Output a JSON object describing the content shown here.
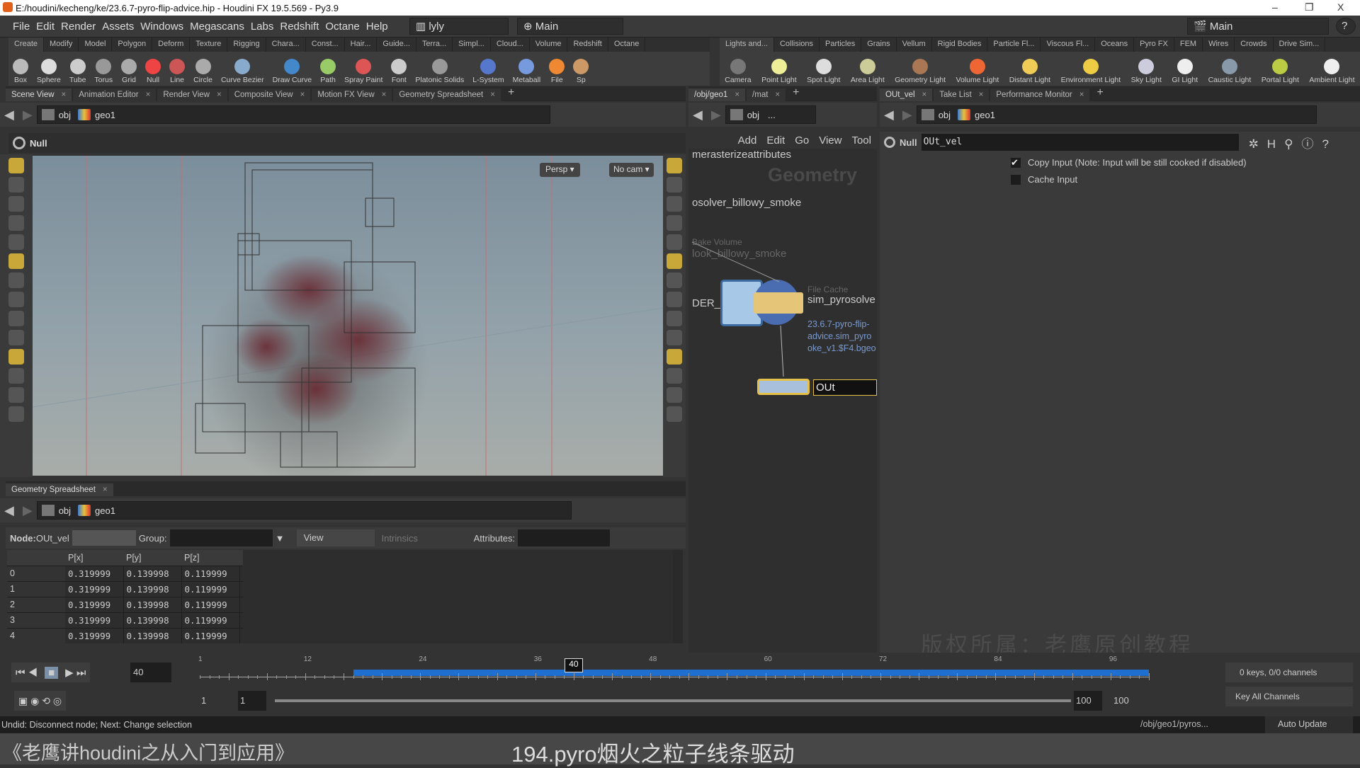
{
  "window": {
    "title": "E:/houdini/kecheng/ke/23.6.7-pyro-flip-advice.hip - Houdini FX 19.5.569 - Py3.9",
    "minimize": "–",
    "maximize": "❐",
    "close": "X"
  },
  "menu": [
    "File",
    "Edit",
    "Render",
    "Assets",
    "Windows",
    "Megascans",
    "Labs",
    "Redshift",
    "Octane",
    "Help"
  ],
  "desktop": "lyly",
  "main_sel": "Main",
  "main_right": "Main",
  "help": "?",
  "shelf_left_tabs": [
    "Create",
    "Modify",
    "Model",
    "Polygon",
    "Deform",
    "Texture",
    "Rigging",
    "Chara...",
    "Const...",
    "Hair...",
    "Guide...",
    "Terra...",
    "Simpl...",
    "Cloud...",
    "Volume",
    "Redshift",
    "Octane"
  ],
  "shelf_left_tools": [
    "Box",
    "Sphere",
    "Tube",
    "Torus",
    "Grid",
    "Null",
    "Line",
    "Circle",
    "Curve Bezier",
    "Draw Curve",
    "Path",
    "Spray Paint",
    "Font",
    "Platonic Solids",
    "L-System",
    "Metaball",
    "File",
    "Sp"
  ],
  "shelf_right_tabs": [
    "Lights and...",
    "Collisions",
    "Particles",
    "Grains",
    "Vellum",
    "Rigid Bodies",
    "Particle Fl...",
    "Viscous Fl...",
    "Oceans",
    "Pyro FX",
    "FEM",
    "Wires",
    "Crowds",
    "Drive Sim..."
  ],
  "shelf_right_tools": [
    "Camera",
    "Point Light",
    "Spot Light",
    "Area Light",
    "Geometry Light",
    "Volume Light",
    "Distant Light",
    "Environment Light",
    "Sky Light",
    "GI Light",
    "Caustic Light",
    "Portal Light",
    "Ambient Light"
  ],
  "left_tabs": [
    "Scene View",
    "Animation Editor",
    "Render View",
    "Composite View",
    "Motion FX View",
    "Geometry Spreadsheet"
  ],
  "path": {
    "obj": "obj",
    "geo": "geo1"
  },
  "viewport": {
    "node_type": "Null",
    "persp": "Persp ▾",
    "cam": "No cam ▾"
  },
  "net": {
    "tabs": [
      "/obj/geo1",
      "/mat"
    ],
    "path_obj": "obj",
    "path_more": "...",
    "menu": [
      "Add",
      "Edit",
      "Go",
      "View",
      "Tool"
    ],
    "label_top": "merasterizeattributes",
    "watermark": "Geometry",
    "node1": "osolver_billowy_smoke",
    "bake_type": "Bake Volume",
    "bake_name": "look_billowy_smoke",
    "left_cut": "DER_B",
    "cache_type": "File Cache",
    "cache_name": "sim_pyrosolve",
    "cache_file": [
      "23.6.7-pyro-flip-",
      "advice.sim_pyro",
      "oke_v1.$F4.bgeo"
    ],
    "null_type": "Null",
    "null_name": "OUt"
  },
  "params": {
    "tabs": [
      "OUt_vel",
      "Take List",
      "Performance Monitor"
    ],
    "node_type": "Null",
    "node_name": "OUt_vel",
    "copy_input": "Copy Input (Note: Input will be still cooked if disabled)",
    "copy_checked": true,
    "cache_input": "Cache Input",
    "cache_checked": false
  },
  "spreadsheet": {
    "tab": "Geometry Spreadsheet",
    "node_label": "Node:",
    "node": "OUt_vel",
    "group_label": "Group:",
    "view": "View",
    "intrinsics": "Intrinsics",
    "attributes_label": "Attributes:",
    "columns": [
      "",
      "P[x]",
      "P[y]",
      "P[z]"
    ],
    "rows": [
      [
        "0",
        "0.319999",
        "0.139998",
        "0.119999"
      ],
      [
        "1",
        "0.319999",
        "0.139998",
        "0.119999"
      ],
      [
        "2",
        "0.319999",
        "0.139998",
        "0.119999"
      ],
      [
        "3",
        "0.319999",
        "0.139998",
        "0.119999"
      ],
      [
        "4",
        "0.319999",
        "0.139998",
        "0.119999"
      ]
    ]
  },
  "timeline": {
    "frame": "40",
    "ticks": [
      "1",
      "12",
      "24",
      "36",
      "48",
      "60",
      "72",
      "84",
      "96"
    ],
    "cursor": "40",
    "start": "1",
    "start2": "1",
    "end": "100",
    "end2": "100",
    "keys": "0 keys, 0/0 channels",
    "key_all": "Key All Channels",
    "range_start": 1,
    "range_end": 100,
    "cached_from": 17,
    "cached_to": 100
  },
  "status": {
    "text": "Undid: Disconnect node; Next: Change selection",
    "path": "/obj/geo1/pyros...",
    "update": "Auto Update"
  },
  "overlay": {
    "watermark": "版权所属：老鹰原创教程",
    "course": "《老鹰讲houdini之从入门到应用》",
    "lesson": "194.pyro烟火之粒子线条驱动"
  },
  "colors": {
    "accent": "#1f6fd1",
    "node_selected": "#e6c14a"
  }
}
